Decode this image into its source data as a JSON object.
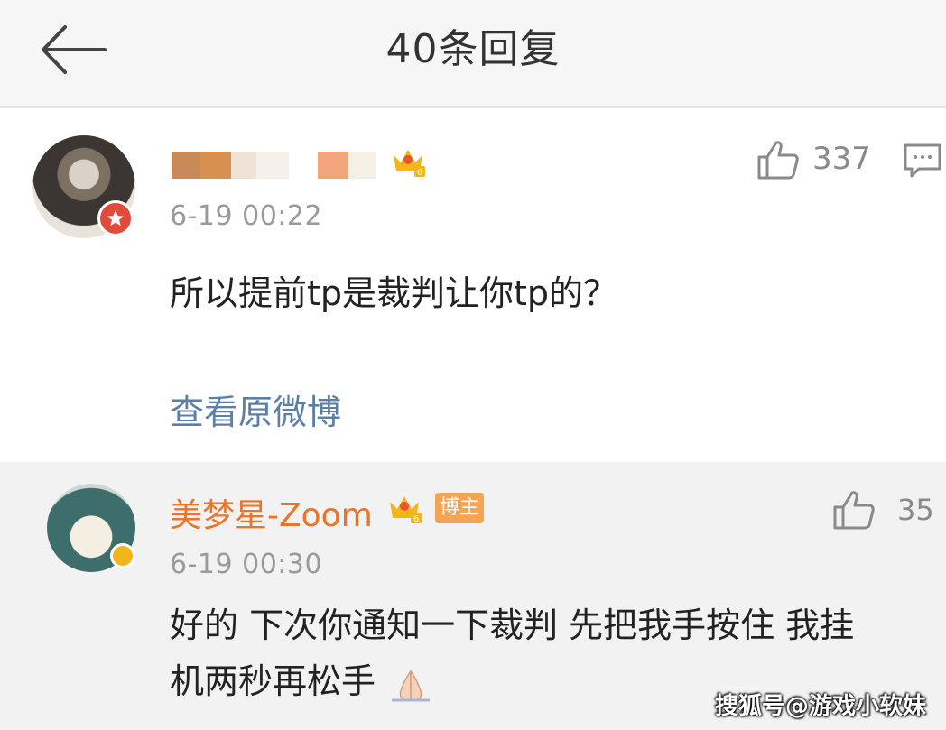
{
  "header": {
    "title": "40条回复",
    "back_icon": "arrow-left-icon"
  },
  "main_comment": {
    "username_hidden": true,
    "level_badge": "6",
    "time": "6-19 00:22",
    "text": "所以提前tp是裁判让你tp的？",
    "likes": "337",
    "view_original": "查看原微博"
  },
  "reply": {
    "username": "美梦星-Zoom",
    "level_badge": "6",
    "role_badge": "博主",
    "time": "6-19 00:30",
    "text_line1": "好的 下次你通知一下裁判 先把我手按住 我挂",
    "text_line2": "机两秒再松手",
    "likes": "35"
  },
  "watermark": "搜狐号@游戏小软妹",
  "colors": {
    "link": "#5b7fa6",
    "reply_name": "#e9742a",
    "badge": "#f4a455",
    "crown": "#f2b51b"
  }
}
